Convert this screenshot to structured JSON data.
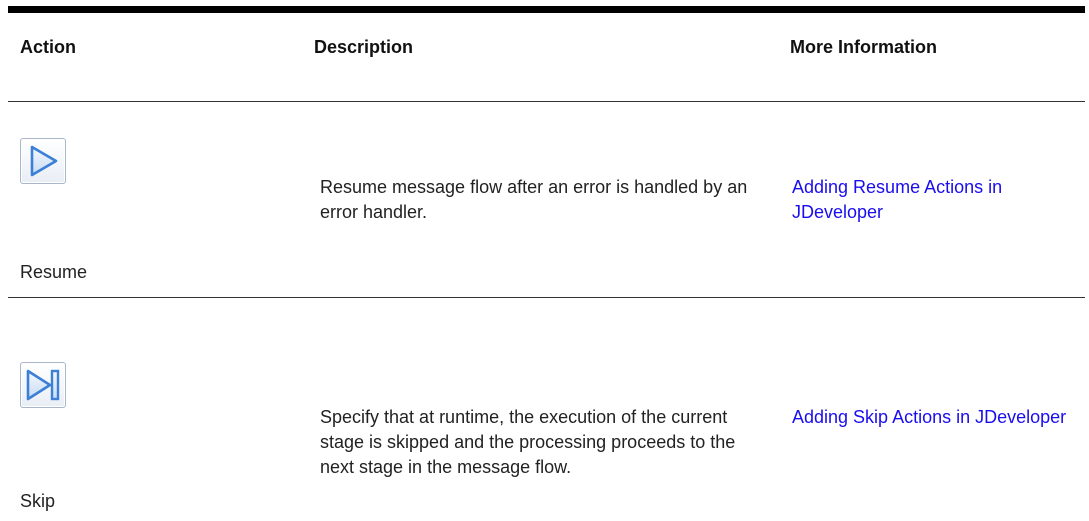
{
  "table": {
    "headers": {
      "action": "Action",
      "description": "Description",
      "more_info": "More Information"
    },
    "rows": [
      {
        "icon": "resume-play-icon",
        "action": "Resume",
        "description": "Resume message flow after an error is handled by an error handler.",
        "more_info_link": "Adding Resume Actions in JDeveloper"
      },
      {
        "icon": "skip-forward-icon",
        "action": "Skip",
        "description": "Specify that at runtime, the execution of the current stage is skipped and the processing proceeds to the next stage in the message flow.",
        "more_info_link": "Adding Skip Actions in JDeveloper"
      }
    ]
  },
  "colors": {
    "link": "#1a0dee",
    "icon_blue": "#3b7fd6",
    "rule": "#000000"
  }
}
